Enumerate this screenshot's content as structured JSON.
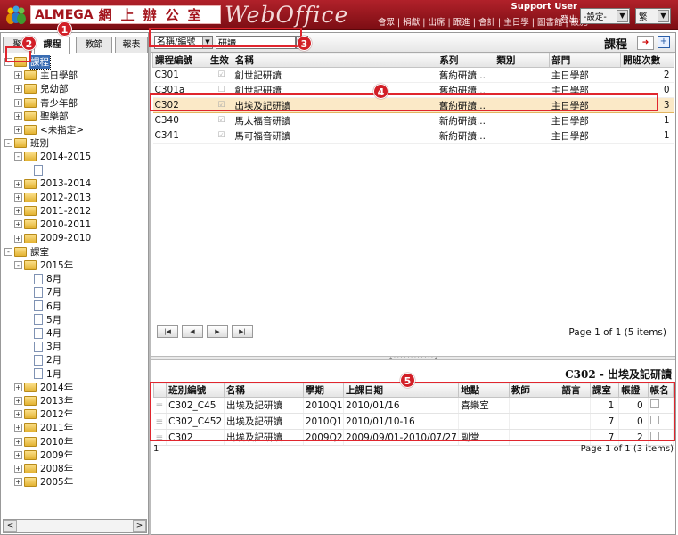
{
  "header": {
    "brand_name": "ALMEGA",
    "brand_zh": "網上辦公室",
    "product": "WebOffice",
    "nav": "會眾 | 捐獻 | 出席 | 跟進 | 會計 | 主日學 | 圖書館 | 設施",
    "user": "Support User",
    "logout": "登出",
    "settings_select": "-設定-",
    "lang_select": "繁"
  },
  "sidebar": {
    "tabs": [
      "聚",
      "課程",
      "教節",
      "報表"
    ],
    "tree": [
      {
        "label": "課程",
        "level": 0,
        "type": "folder",
        "exp": "-",
        "selected": true
      },
      {
        "label": "主日學部",
        "level": 1,
        "type": "folder",
        "exp": "+"
      },
      {
        "label": "兒幼部",
        "level": 1,
        "type": "folder",
        "exp": "+"
      },
      {
        "label": "青少年部",
        "level": 1,
        "type": "folder",
        "exp": "+"
      },
      {
        "label": "聖樂部",
        "level": 1,
        "type": "folder",
        "exp": "+"
      },
      {
        "label": "<未指定>",
        "level": 1,
        "type": "folder",
        "exp": "+"
      },
      {
        "label": "班別",
        "level": 0,
        "type": "folder",
        "exp": "-"
      },
      {
        "label": "2014-2015",
        "level": 1,
        "type": "folder",
        "exp": "-"
      },
      {
        "label": "",
        "level": 2,
        "type": "doc",
        "exp": ""
      },
      {
        "label": "2013-2014",
        "level": 1,
        "type": "folder",
        "exp": "+"
      },
      {
        "label": "2012-2013",
        "level": 1,
        "type": "folder",
        "exp": "+"
      },
      {
        "label": "2011-2012",
        "level": 1,
        "type": "folder",
        "exp": "+"
      },
      {
        "label": "2010-2011",
        "level": 1,
        "type": "folder",
        "exp": "+"
      },
      {
        "label": "2009-2010",
        "level": 1,
        "type": "folder",
        "exp": "+"
      },
      {
        "label": "課室",
        "level": 0,
        "type": "folder",
        "exp": "-"
      },
      {
        "label": "2015年",
        "level": 1,
        "type": "folder",
        "exp": "-"
      },
      {
        "label": "8月",
        "level": 2,
        "type": "doc",
        "exp": ""
      },
      {
        "label": "7月",
        "level": 2,
        "type": "doc",
        "exp": ""
      },
      {
        "label": "6月",
        "level": 2,
        "type": "doc",
        "exp": ""
      },
      {
        "label": "5月",
        "level": 2,
        "type": "doc",
        "exp": ""
      },
      {
        "label": "4月",
        "level": 2,
        "type": "doc",
        "exp": ""
      },
      {
        "label": "3月",
        "level": 2,
        "type": "doc",
        "exp": ""
      },
      {
        "label": "2月",
        "level": 2,
        "type": "doc",
        "exp": ""
      },
      {
        "label": "1月",
        "level": 2,
        "type": "doc",
        "exp": ""
      },
      {
        "label": "2014年",
        "level": 1,
        "type": "folder",
        "exp": "+"
      },
      {
        "label": "2013年",
        "level": 1,
        "type": "folder",
        "exp": "+"
      },
      {
        "label": "2012年",
        "level": 1,
        "type": "folder",
        "exp": "+"
      },
      {
        "label": "2011年",
        "level": 1,
        "type": "folder",
        "exp": "+"
      },
      {
        "label": "2010年",
        "level": 1,
        "type": "folder",
        "exp": "+"
      },
      {
        "label": "2009年",
        "level": 1,
        "type": "folder",
        "exp": "+"
      },
      {
        "label": "2008年",
        "level": 1,
        "type": "folder",
        "exp": "+"
      },
      {
        "label": "2005年",
        "level": 1,
        "type": "folder",
        "exp": "+"
      }
    ],
    "scroll_left": "<",
    "scroll_right": ">"
  },
  "toolbar": {
    "field_select": "名稱/編號",
    "search_value": "研讀",
    "title": "課程"
  },
  "courses": {
    "columns": [
      "課程編號",
      "生效",
      "名稱",
      "系列",
      "類別",
      "部門",
      "開班次數"
    ],
    "rows": [
      {
        "code": "C301",
        "active": "☑",
        "name": "創世記研讀",
        "series": "舊約研讀...",
        "category": "",
        "dept": "主日學部",
        "count": "2"
      },
      {
        "code": "C301a",
        "active": "☐",
        "name": "創世記研讀",
        "series": "舊約研讀...",
        "category": "",
        "dept": "主日學部",
        "count": "0"
      },
      {
        "code": "C302",
        "active": "☑",
        "name": "出埃及記研讀",
        "series": "舊約研讀...",
        "category": "",
        "dept": "主日學部",
        "count": "3"
      },
      {
        "code": "C340",
        "active": "☑",
        "name": "馬太福音研讀",
        "series": "新約研讀...",
        "category": "",
        "dept": "主日學部",
        "count": "1"
      },
      {
        "code": "C341",
        "active": "☑",
        "name": "馬可福音研讀",
        "series": "新約研讀...",
        "category": "",
        "dept": "主日學部",
        "count": "1"
      }
    ],
    "selected_index": 2,
    "pager": "Page 1 of 1 (5 items)"
  },
  "detail": {
    "title": "C302 - 出埃及記研讀",
    "columns": [
      "班別編號",
      "名稱",
      "學期",
      "上課日期",
      "地點",
      "教師",
      "語言",
      "課室",
      "帳證",
      "帳名"
    ],
    "rows": [
      {
        "code": "C302_C45",
        "name": "出埃及記研讀",
        "term": "2010Q1",
        "dates": "2010/01/16",
        "place": "喜樂室",
        "teacher": "",
        "lang": "",
        "room": "1",
        "v1": "0"
      },
      {
        "code": "C302_C452",
        "name": "出埃及記研讀",
        "term": "2010Q1",
        "dates": "2010/01/10-16",
        "place": "",
        "teacher": "",
        "lang": "",
        "room": "7",
        "v1": "0"
      },
      {
        "code": "C302",
        "name": "出埃及記研讀",
        "term": "2009Q2",
        "dates": "2009/09/01-2010/07/27",
        "place": "副堂",
        "teacher": "",
        "lang": "",
        "room": "7",
        "v1": "2"
      }
    ],
    "count": "1",
    "pager": "Page 1 of 1 (3 items)"
  },
  "callouts": [
    "1",
    "2",
    "3",
    "4",
    "5"
  ]
}
